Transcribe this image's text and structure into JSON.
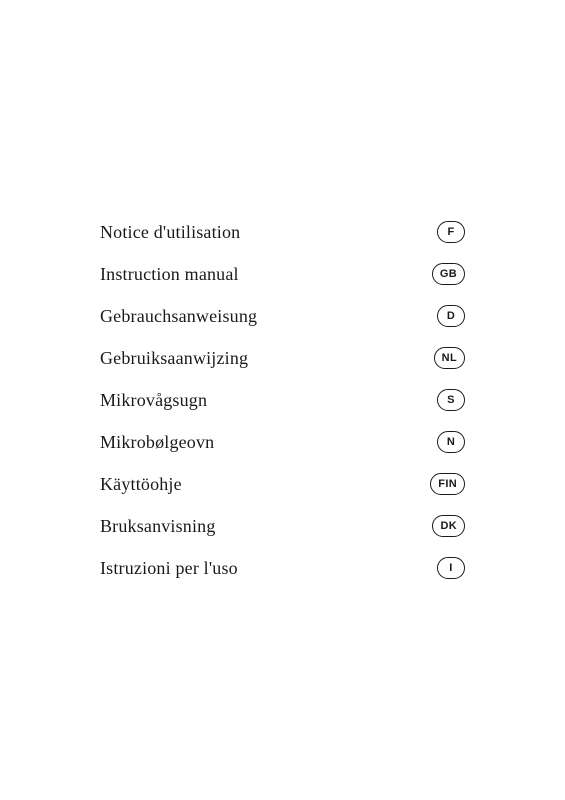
{
  "manuals": [
    {
      "title": "Notice d'utilisation",
      "lang": "F"
    },
    {
      "title": "Instruction manual",
      "lang": "GB"
    },
    {
      "title": "Gebrauchsanweisung",
      "lang": "D"
    },
    {
      "title": "Gebruiksaanwijzing",
      "lang": "NL"
    },
    {
      "title": "Mikrovågsugn",
      "lang": "S"
    },
    {
      "title": "Mikrobølgeovn",
      "lang": "N"
    },
    {
      "title": "Käyttöohje",
      "lang": "FIN"
    },
    {
      "title": "Bruksanvisning",
      "lang": "DK"
    },
    {
      "title": "Istruzioni per l'uso",
      "lang": "I"
    }
  ]
}
